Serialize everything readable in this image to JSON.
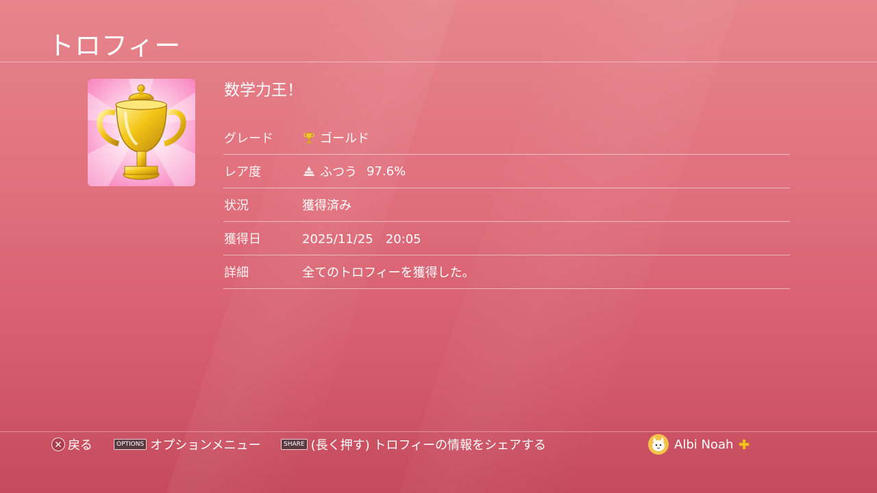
{
  "header": {
    "title": "トロフィー"
  },
  "trophy": {
    "name": "数学力王！",
    "icon": "gold-cup-icon",
    "details": [
      {
        "label": "グレード",
        "value": "ゴールド",
        "icon": "trophy-gold-icon"
      },
      {
        "label": "レア度",
        "value": "ふつう",
        "percent": "97.6%",
        "icon": "rarity-pyramid-icon"
      },
      {
        "label": "状況",
        "value": "獲得済み"
      },
      {
        "label": "獲得日",
        "value": "2025/11/25　20:05"
      },
      {
        "label": "詳細",
        "value": "全てのトロフィーを獲得した。"
      }
    ]
  },
  "footer": {
    "back": {
      "icon": "cross-button-icon",
      "label": "戻る"
    },
    "options": {
      "key": "OPTIONS",
      "label": "オプションメニュー"
    },
    "share": {
      "key": "SHARE",
      "label": "(長く押す) トロフィーの情報をシェアする"
    },
    "user": {
      "name": "Albi Noah",
      "icon": "ps-plus-icon"
    }
  },
  "colors": {
    "background_top": "#e6858b",
    "background_bottom": "#c44a5c",
    "gold": "#f2c24a"
  }
}
